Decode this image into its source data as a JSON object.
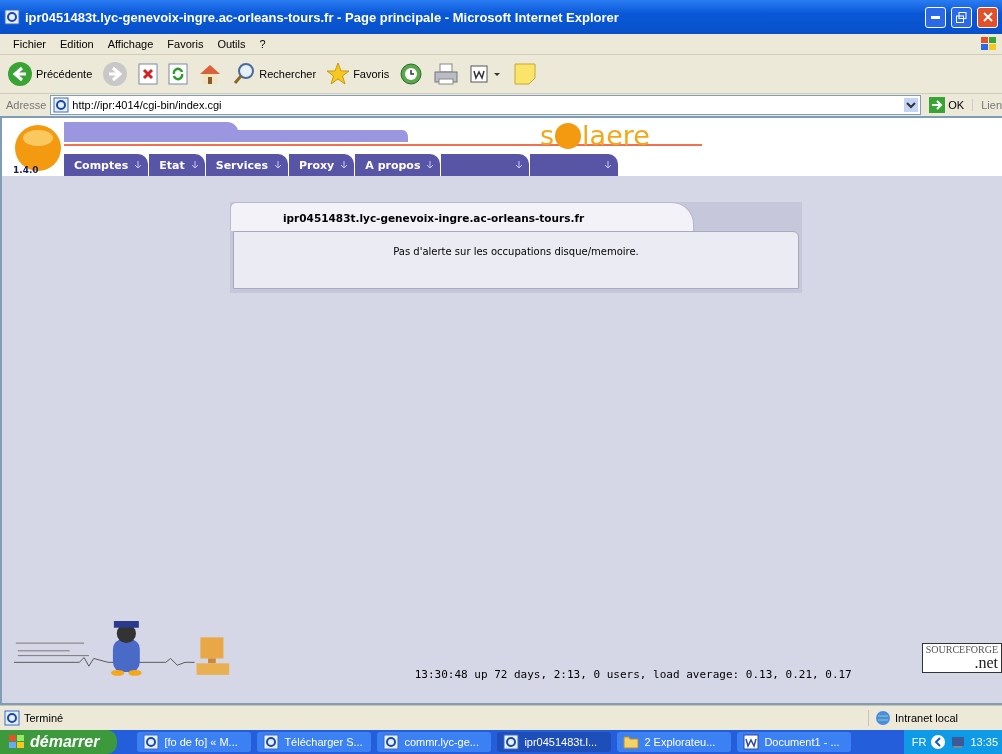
{
  "window": {
    "title": "ipr0451483t.lyc-genevoix-ingre.ac-orleans-tours.fr - Page principale - Microsoft Internet Explorer"
  },
  "menu": [
    "Fichier",
    "Edition",
    "Affichage",
    "Favoris",
    "Outils",
    "?"
  ],
  "toolbar": [
    {
      "kind": "back",
      "label": "Précédente"
    },
    {
      "kind": "forward"
    },
    {
      "kind": "stop"
    },
    {
      "kind": "refresh"
    },
    {
      "kind": "home"
    },
    {
      "kind": "search",
      "label": "Rechercher"
    },
    {
      "kind": "favorites",
      "label": "Favoris"
    },
    {
      "kind": "history"
    },
    {
      "kind": "print"
    },
    {
      "kind": "word"
    },
    {
      "kind": "note"
    }
  ],
  "address": {
    "label": "Adresse",
    "value": "http://ipr:4014/cgi-bin/index.cgi",
    "go": "OK",
    "links": "Lien"
  },
  "site": {
    "version": "1.4.0",
    "logo_start": "s",
    "logo_end": "laere",
    "tabs": [
      {
        "kind": "text",
        "label": "Comptes"
      },
      {
        "kind": "text",
        "label": "Etat"
      },
      {
        "kind": "text",
        "label": "Services"
      },
      {
        "kind": "text",
        "label": "Proxy"
      },
      {
        "kind": "text",
        "label": "A propos"
      },
      {
        "kind": "blank"
      },
      {
        "kind": "blank"
      }
    ],
    "card": {
      "title": "ipr0451483t.lyc-genevoix-ingre.ac-orleans-tours.fr",
      "message": "Pas d'alerte sur les occupations disque/memoire."
    },
    "uptime": "13:30:48 up 72 days, 2:13, 0 users, load average: 0.13, 0.21, 0.17",
    "badge": {
      "top": "SOURCEFORGE",
      "bottom": ".net"
    }
  },
  "status_bar": {
    "text": "Terminé",
    "zone": "Intranet local"
  },
  "taskbar": {
    "start": "démarrer",
    "items": [
      {
        "kind": "ie",
        "label": "[fo de fo] « M...",
        "selected": false
      },
      {
        "kind": "ie",
        "label": "Télécharger S...",
        "selected": false
      },
      {
        "kind": "ie",
        "label": "commr.lyc-ge...",
        "selected": false
      },
      {
        "kind": "ie",
        "label": "ipr0451483t.l...",
        "selected": true
      },
      {
        "kind": "folder",
        "label": "2 Explorateu...",
        "selected": false
      },
      {
        "kind": "word",
        "label": "Document1 - ...",
        "selected": false
      }
    ],
    "lang": "FR",
    "clock": "13:35"
  }
}
